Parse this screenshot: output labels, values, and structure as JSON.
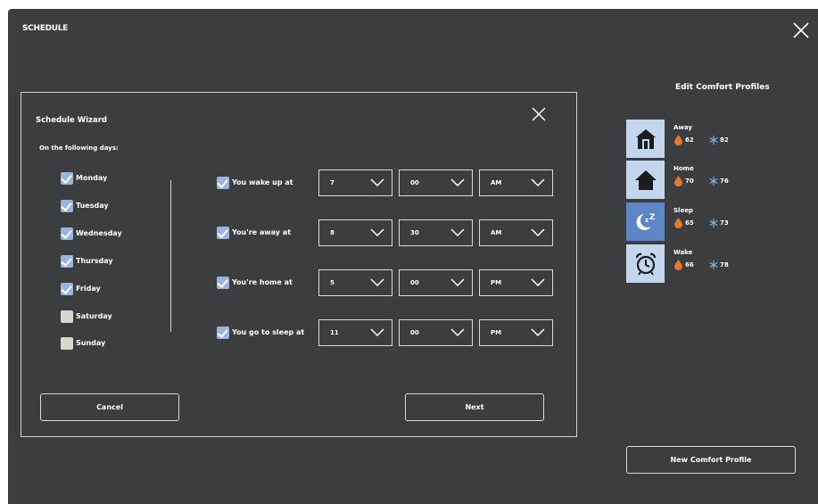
{
  "app": {
    "title": "SCHEDULE"
  },
  "wizard": {
    "title": "Schedule Wizard",
    "days_label": "On the following days:",
    "days": [
      {
        "label": "Monday",
        "checked": true
      },
      {
        "label": "Tuesday",
        "checked": true
      },
      {
        "label": "Wednesday",
        "checked": true
      },
      {
        "label": "Thursday",
        "checked": true
      },
      {
        "label": "Friday",
        "checked": true
      },
      {
        "label": "Saturday",
        "checked": false
      },
      {
        "label": "Sunday",
        "checked": false
      }
    ],
    "events": [
      {
        "label": "You wake up at",
        "checked": true,
        "hour": "7",
        "minute": "00",
        "ampm": "AM"
      },
      {
        "label": "You're away at",
        "checked": true,
        "hour": "8",
        "minute": "30",
        "ampm": "AM"
      },
      {
        "label": "You're home at",
        "checked": true,
        "hour": "5",
        "minute": "00",
        "ampm": "PM"
      },
      {
        "label": "You go to sleep at",
        "checked": true,
        "hour": "11",
        "minute": "00",
        "ampm": "PM"
      }
    ],
    "cancel_label": "Cancel",
    "next_label": "Next"
  },
  "profiles": {
    "title": "Edit Comfort Profiles",
    "items": [
      {
        "name": "Away",
        "heat": "62",
        "cool": "82",
        "icon": "away-house-icon",
        "active": false
      },
      {
        "name": "Home",
        "heat": "70",
        "cool": "76",
        "icon": "home-house-icon",
        "active": false
      },
      {
        "name": "Sleep",
        "heat": "65",
        "cool": "73",
        "icon": "moon-zz-icon",
        "active": true
      },
      {
        "name": "Wake",
        "heat": "66",
        "cool": "78",
        "icon": "alarm-clock-icon",
        "active": false
      }
    ],
    "new_label": "New Comfort Profile"
  },
  "colors": {
    "background": "#3b3d3f",
    "checkbox_checked": "#9ab4dc",
    "checkbox_unchecked": "#d8d6cd",
    "tile": "#c4d6ee",
    "tile_active": "#5e85c4",
    "heat": "#e07a2e",
    "cool": "#7fb4e0"
  }
}
